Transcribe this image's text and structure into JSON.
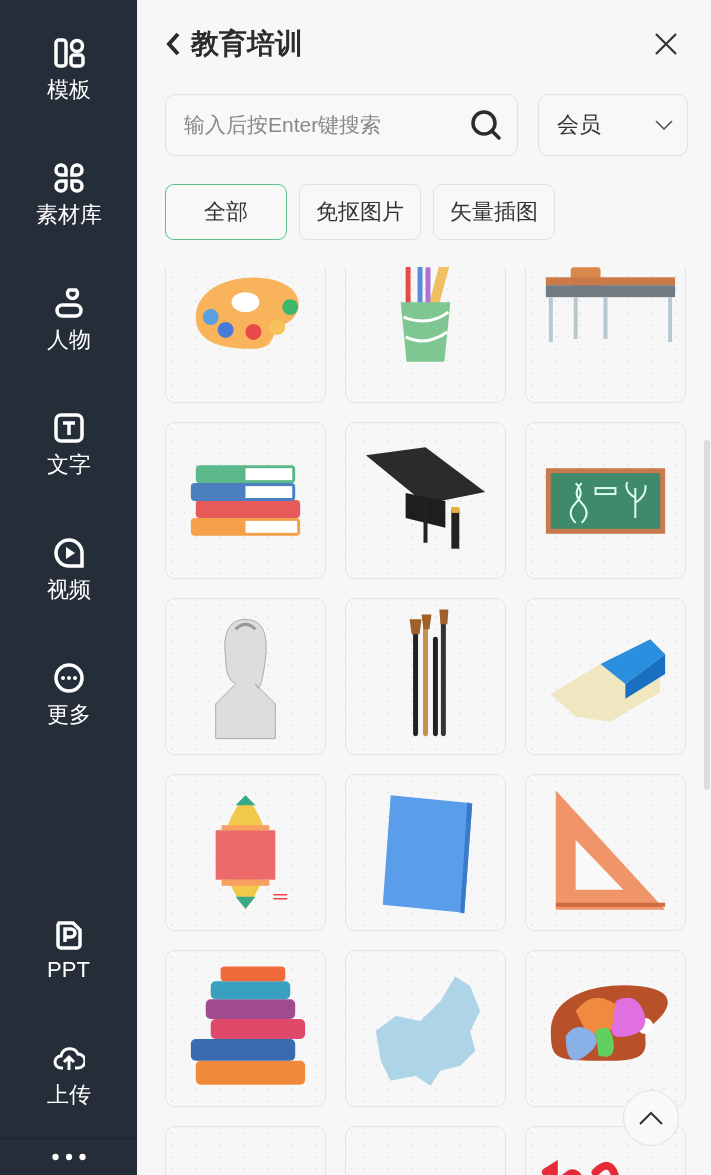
{
  "sidebar": {
    "items": [
      {
        "kind": "template",
        "label": "模板"
      },
      {
        "kind": "assets",
        "label": "素材库"
      },
      {
        "kind": "person",
        "label": "人物"
      },
      {
        "kind": "text",
        "label": "文字"
      },
      {
        "kind": "video",
        "label": "视频"
      },
      {
        "kind": "more",
        "label": "更多"
      },
      {
        "kind": "ppt",
        "label": "PPT"
      },
      {
        "kind": "upload",
        "label": "上传"
      }
    ]
  },
  "panel": {
    "title": "教育培训",
    "search": {
      "placeholder": "输入后按Enter键搜索"
    },
    "filter": {
      "value": "会员"
    },
    "chips": [
      {
        "label": "全部",
        "selected": true
      },
      {
        "label": "免抠图片",
        "selected": false
      },
      {
        "label": "矢量插图",
        "selected": false
      }
    ],
    "tiles": [
      {
        "kind": "palette"
      },
      {
        "kind": "pencil-cup"
      },
      {
        "kind": "desk"
      },
      {
        "kind": "books"
      },
      {
        "kind": "grad-cap"
      },
      {
        "kind": "chalkboard"
      },
      {
        "kind": "bust"
      },
      {
        "kind": "brushes"
      },
      {
        "kind": "eraser"
      },
      {
        "kind": "infographic"
      },
      {
        "kind": "book"
      },
      {
        "kind": "set-square"
      },
      {
        "kind": "book-stack"
      },
      {
        "kind": "map"
      },
      {
        "kind": "paint-palette"
      },
      {
        "kind": "blank"
      },
      {
        "kind": "blank"
      },
      {
        "kind": "scribble"
      }
    ]
  }
}
